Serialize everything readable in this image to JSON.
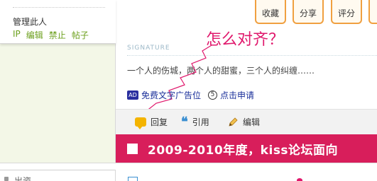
{
  "sidebar": {
    "manage_label": "管理此人",
    "actions": [
      "IP",
      "编辑",
      "禁止",
      "帖子"
    ],
    "bottom_partial_label": "出资..."
  },
  "top_buttons": {
    "favorite": "收藏",
    "share": "分享",
    "rate": "评分"
  },
  "signature": {
    "label": "SIGNATURE",
    "text": "一个人的伤城，两个人的甜蜜，三个人的纠缠……"
  },
  "annotation": {
    "text": "怎么对齐？",
    "color": "#e0186c"
  },
  "ads": {
    "badge": "AD",
    "free_text_ad": "免费文字广告位",
    "apply_icon_glyph": "5",
    "apply_link": "点击申请"
  },
  "post_actions": {
    "reply": "回复",
    "quote": "引用",
    "edit": "编辑"
  },
  "banner": {
    "text": "2009-2010年度，kiss论坛面向",
    "background_color": "#d81e5b"
  },
  "colors": {
    "accent_green": "#6b9f1b",
    "button_border": "#f0a040",
    "link_blue": "#1a2f9a"
  }
}
